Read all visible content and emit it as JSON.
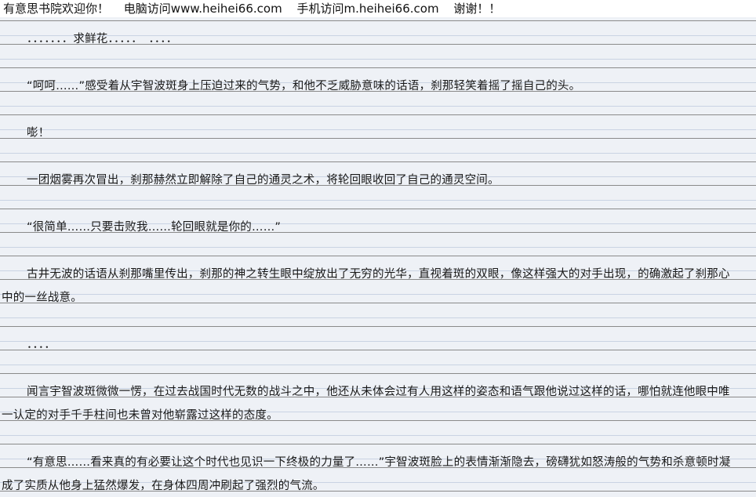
{
  "header": {
    "welcome": "有意思书院欢迎你！",
    "pc_access": "电脑访问www.heihei66.com",
    "mobile_access": "手机访问m.heihei66.com",
    "thanks": "谢谢！！"
  },
  "paragraphs": [
    "．．．．．．．求鲜花．．．．．　．．．．",
    "“呵呵……”感受着从宇智波斑身上压迫过来的气势，和他不乏威胁意味的话语，刹那轻笑着摇了摇自己的头。",
    "嘭！",
    "一团烟雾再次冒出，刹那赫然立即解除了自己的通灵之术，将轮回眼收回了自己的通灵空间。",
    "“很简单……只要击败我……轮回眼就是你的……”",
    "古井无波的话语从刹那嘴里传出，刹那的神之转生眼中绽放出了无穷的光华，直视着斑的双眼，像这样强大的对手出现，的确激起了刹那心中的一丝战意。",
    "．．．．",
    "闻言宇智波斑微微一愣，在过去战国时代无数的战斗之中，他还从未体会过有人用这样的姿态和语气跟他说过这样的话，哪怕就连他眼中唯一认定的对手千手柱间也未曾对他崭露过这样的态度。",
    "“有意思……看来真的有必要让这个时代也见识一下终极的力量了……”宇智波斑脸上的表情渐渐隐去，磅礴犹如怒涛般的气势和杀意顿时凝成了实质从他身上猛然爆发，在身体四周冲刷起了强烈的气流。"
  ]
}
